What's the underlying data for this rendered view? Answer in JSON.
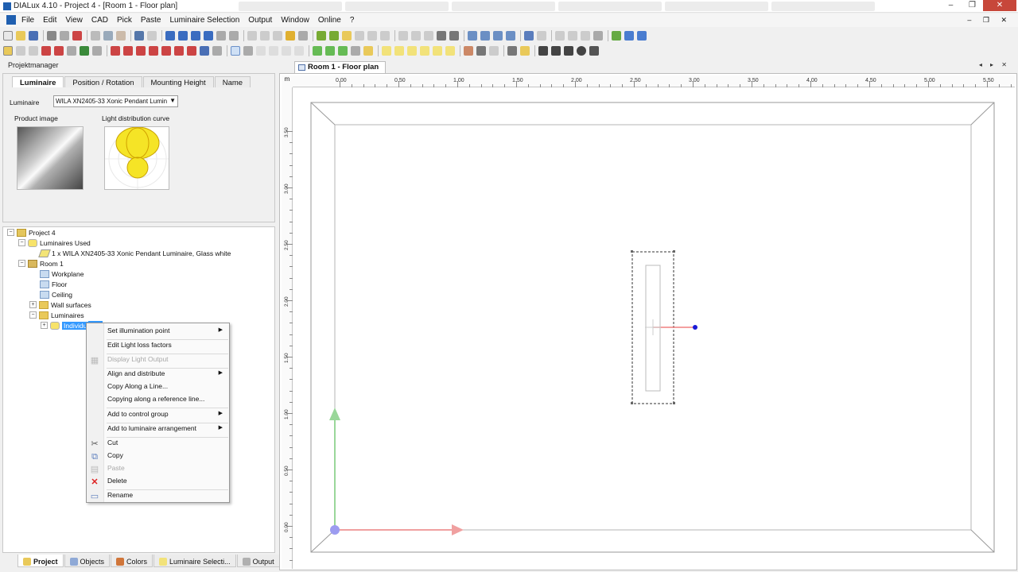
{
  "window": {
    "title": "DIALux 4.10 - Project 4 - [Room 1 - Floor plan]",
    "controls": [
      "–",
      "❐",
      "✕"
    ]
  },
  "menu": {
    "items": [
      "File",
      "Edit",
      "View",
      "CAD",
      "Pick",
      "Paste",
      "Luminaire Selection",
      "Output",
      "Window",
      "Online",
      "?"
    ],
    "mdi_controls": "– ❐ ✕"
  },
  "project_manager": {
    "label": "Projektmanager",
    "tabs": [
      "Luminaire",
      "Position / Rotation",
      "Mounting Height",
      "Name"
    ],
    "luminaire_label": "Luminaire",
    "luminaire_value": "WILA XN2405-33 Xonic Pendant Lumin",
    "product_image_label": "Product image",
    "ldc_label": "Light distribution curve"
  },
  "tree": {
    "project": "Project 4",
    "luminaires_used": "Luminaires Used",
    "luminaire_entry": "1 x WILA XN2405-33 Xonic Pendant Luminaire, Glass white",
    "room": "Room 1",
    "workplane": "Workplane",
    "floor": "Floor",
    "ceiling": "Ceiling",
    "wall_surfaces": "Wall surfaces",
    "luminaires": "Luminaires",
    "individual": "Individu"
  },
  "context_menu": {
    "set_illumination_point": "Set illumination point",
    "edit_light_loss": "Edit Light loss factors",
    "display_light_output": "Display Light Output",
    "align_distribute": "Align and distribute",
    "copy_along_line": "Copy Along a Line...",
    "copy_along_ref": "Copying along a reference line...",
    "add_control_group": "Add to control group",
    "add_luminaire_arrangement": "Add to luminaire arrangement",
    "cut": "Cut",
    "copy": "Copy",
    "paste": "Paste",
    "delete": "Delete",
    "rename": "Rename"
  },
  "bottom_tabs": [
    "Project",
    "Objects",
    "Colors",
    "Luminaire Selecti...",
    "Output"
  ],
  "document": {
    "tab_title": "Room 1 - Floor plan",
    "ruler_unit": "m",
    "x_ruler_labels": [
      "0.00",
      "0.50",
      "1.00",
      "1.50",
      "2.00",
      "2.50",
      "3.00",
      "3.50",
      "4.00",
      "4.50",
      "5.00",
      "5.50"
    ],
    "y_ruler_labels": [
      "3.50",
      "3.00",
      "2.50",
      "2.00",
      "1.50",
      "1.00",
      "0.50",
      "0.00"
    ]
  },
  "colors": {
    "selection": "#3399ff",
    "axis_x": "#f0a0a0",
    "axis_y": "#9ad79a",
    "origin": "#9c9cf0",
    "handle": "#1a1ad6"
  }
}
